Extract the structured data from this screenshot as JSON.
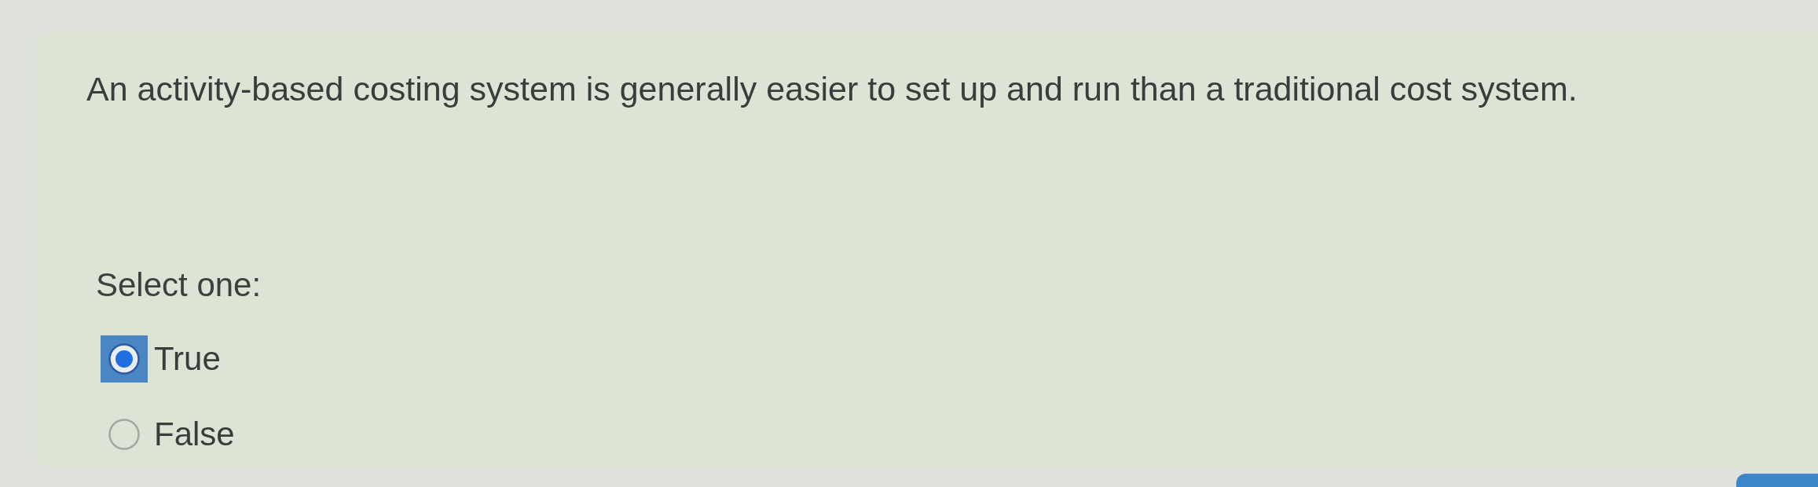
{
  "question": {
    "text": "An activity-based costing system is generally easier to set up and run than a traditional cost system."
  },
  "prompt": "Select one:",
  "options": [
    {
      "label": "True",
      "selected": true,
      "focused": true
    },
    {
      "label": "False",
      "selected": false,
      "focused": false
    }
  ]
}
